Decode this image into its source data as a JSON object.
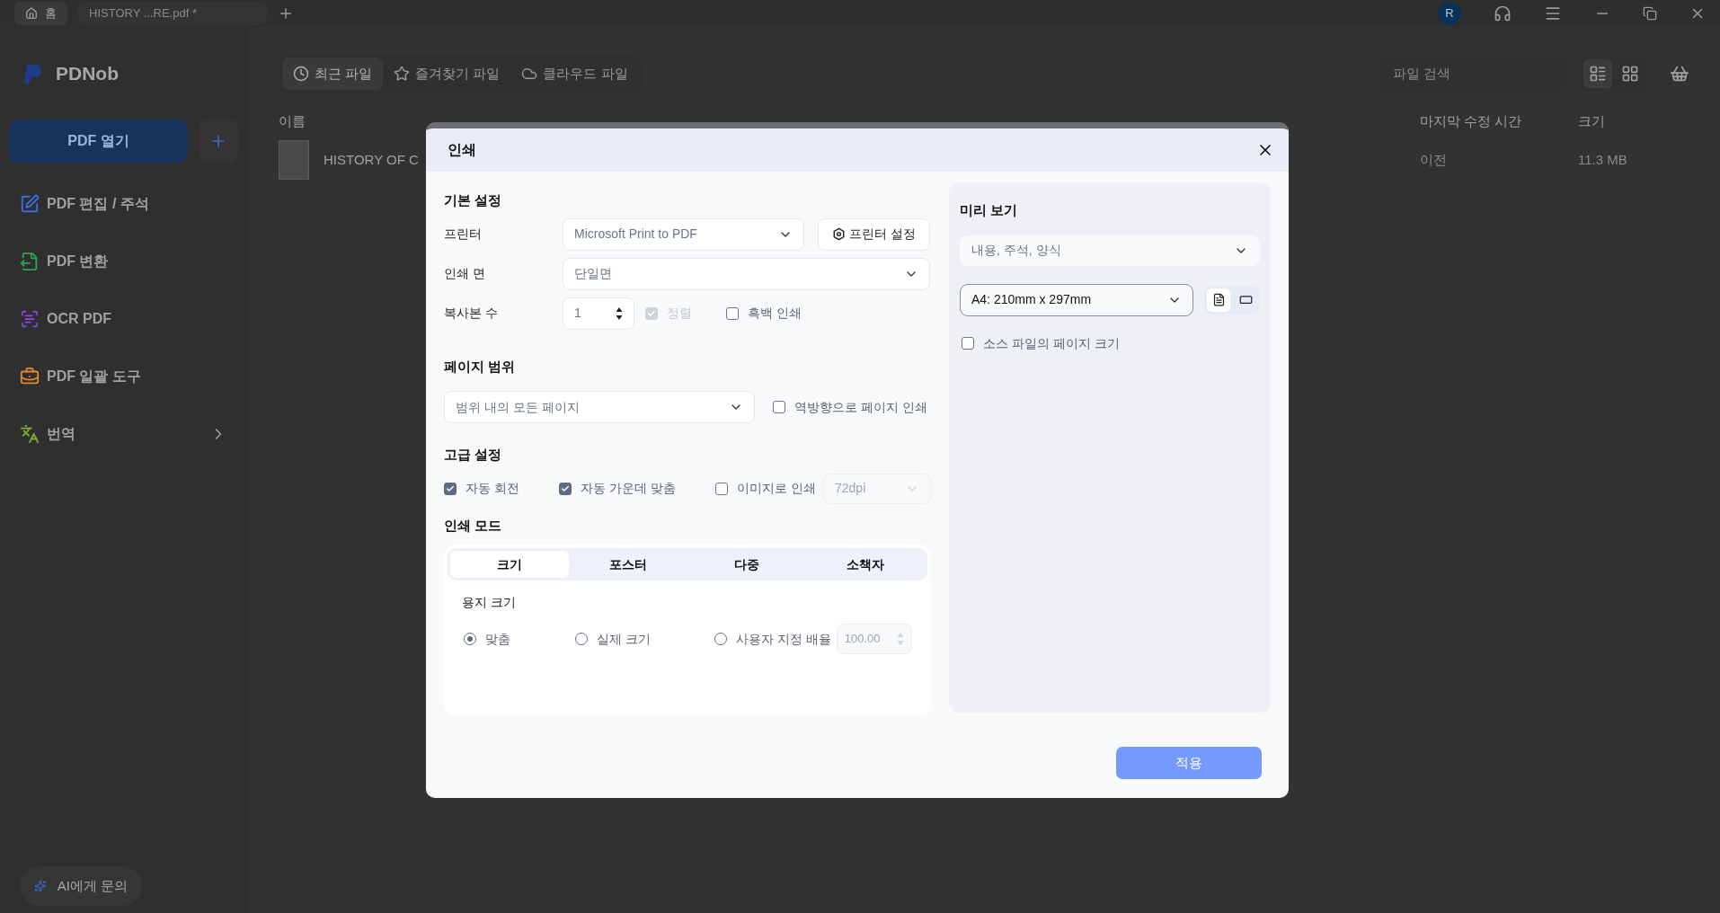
{
  "tabs": [
    {
      "label": "홈",
      "kind": "home",
      "selected": true
    },
    {
      "label": "HISTORY ...RE.pdf *",
      "kind": "file",
      "selected": false
    }
  ],
  "user": {
    "initial": "R"
  },
  "app": {
    "name": "PDNob"
  },
  "sidebar": {
    "open_button": "PDF 열기",
    "items": [
      {
        "label": "PDF 편집 / 주석",
        "kind": "edit"
      },
      {
        "label": "PDF 변환",
        "kind": "convert"
      },
      {
        "label": "OCR PDF",
        "kind": "ocr"
      },
      {
        "label": "PDF 일괄 도구",
        "kind": "batch"
      },
      {
        "label": "번역",
        "kind": "translate"
      }
    ],
    "ai_button": "AI에게 문의"
  },
  "file_tabs": [
    {
      "label": "최근 파일",
      "kind": "recent",
      "selected": true
    },
    {
      "label": "즐겨찾기 파일",
      "kind": "favorite",
      "selected": false
    },
    {
      "label": "클라우드 파일",
      "kind": "cloud",
      "selected": false
    }
  ],
  "search": {
    "placeholder": "파일 검색"
  },
  "view_modes": [
    {
      "kind": "list",
      "selected": true
    },
    {
      "kind": "grid",
      "selected": false
    }
  ],
  "table": {
    "columns": [
      "이름",
      "마지막 수정 시간",
      "크기"
    ],
    "rows": [
      {
        "name": "HISTORY OF C",
        "modified": "이전",
        "size": "11.3 MB"
      }
    ]
  },
  "dialog": {
    "title": "인쇄",
    "basic": {
      "heading": "기본 설정",
      "printer_label": "프린터",
      "printer": "Microsoft Print to PDF",
      "printer_settings": "프린터 설정",
      "sides_label": "인쇄 면",
      "sides": "단일면",
      "copies_label": "복사본 수",
      "copies": "1",
      "collate": {
        "label": "정렬",
        "checked": true,
        "disabled": true
      },
      "grayscale": {
        "label": "흑백 인쇄",
        "checked": false
      }
    },
    "page_range": {
      "heading": "페이지 범위",
      "value": "범위 내의 모든 페이지",
      "reverse": {
        "label": "역방향으로 페이지 인쇄",
        "checked": false
      }
    },
    "advanced": {
      "heading": "고급 설정",
      "options": [
        {
          "label": "자동 회전",
          "checked": true
        },
        {
          "label": "자동 가운데 맞춤",
          "checked": true
        },
        {
          "label": "이미지로 인쇄",
          "checked": false
        }
      ],
      "dpi": {
        "value": "72dpi",
        "disabled": true
      }
    },
    "mode": {
      "heading": "인쇄 모드",
      "tabs": [
        {
          "label": "크기",
          "selected": true
        },
        {
          "label": "포스터",
          "selected": false
        },
        {
          "label": "다중",
          "selected": false
        },
        {
          "label": "소책자",
          "selected": false
        }
      ],
      "paper_label": "용지 크기",
      "options": [
        {
          "label": "맞춤",
          "selected": true
        },
        {
          "label": "실제 크기",
          "selected": false
        },
        {
          "label": "사용자 지정 배율",
          "selected": false
        }
      ],
      "scale": {
        "value": "100.00",
        "disabled": true
      }
    },
    "preview": {
      "heading": "미리 보기",
      "content": "내용, 주석, 양식",
      "paper": "A4: 210mm x 297mm",
      "orientations": [
        {
          "kind": "portrait",
          "selected": true
        },
        {
          "kind": "landscape",
          "selected": false
        }
      ],
      "source_size": {
        "label": "소스 파일의 페이지 크기",
        "checked": false
      }
    },
    "apply": "적용"
  }
}
